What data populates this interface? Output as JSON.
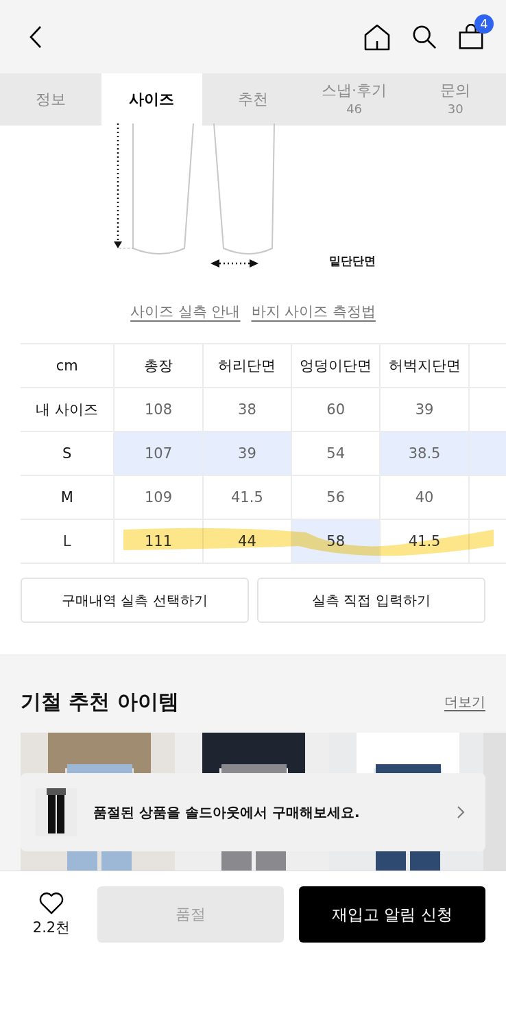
{
  "header": {
    "cart_count": "4"
  },
  "tabs": [
    {
      "label": "정보",
      "selected": false
    },
    {
      "label": "사이즈",
      "selected": true
    },
    {
      "label": "추천",
      "selected": false
    },
    {
      "label": "스냅·후기",
      "count": "46",
      "selected": false
    },
    {
      "label": "문의",
      "count": "30",
      "selected": false
    }
  ],
  "diagram": {
    "label": "밑단단면"
  },
  "links": [
    "사이즈 실측 안내",
    "바지 사이즈 측정법"
  ],
  "size_table": {
    "columns": [
      "cm",
      "총장",
      "허리단면",
      "엉덩이단면",
      "허벅지단면"
    ],
    "rows": [
      {
        "marked": false,
        "edge_highlighted": false,
        "cells": [
          {
            "value": "내 사이즈",
            "highlighted": false
          },
          {
            "value": "108",
            "highlighted": false
          },
          {
            "value": "38",
            "highlighted": false
          },
          {
            "value": "60",
            "highlighted": false
          },
          {
            "value": "39",
            "highlighted": false
          }
        ]
      },
      {
        "marked": false,
        "edge_highlighted": true,
        "cells": [
          {
            "value": "S",
            "highlighted": false
          },
          {
            "value": "107",
            "highlighted": true
          },
          {
            "value": "39",
            "highlighted": true
          },
          {
            "value": "54",
            "highlighted": false
          },
          {
            "value": "38.5",
            "highlighted": true
          }
        ]
      },
      {
        "marked": false,
        "edge_highlighted": false,
        "cells": [
          {
            "value": "M",
            "highlighted": false
          },
          {
            "value": "109",
            "highlighted": false
          },
          {
            "value": "41.5",
            "highlighted": false
          },
          {
            "value": "56",
            "highlighted": false
          },
          {
            "value": "40",
            "highlighted": false
          }
        ]
      },
      {
        "marked": true,
        "edge_highlighted": false,
        "cells": [
          {
            "value": "L",
            "highlighted": false
          },
          {
            "value": "111",
            "highlighted": false
          },
          {
            "value": "44",
            "highlighted": false
          },
          {
            "value": "58",
            "highlighted": true
          },
          {
            "value": "41.5",
            "highlighted": false
          }
        ]
      }
    ]
  },
  "action_buttons": [
    "구매내역 실측 선택하기",
    "실측 직접 입력하기"
  ],
  "recommend": {
    "title": "기철 추천 아이템",
    "more": "더보기"
  },
  "soldout_banner": {
    "text": "품절된 상품을 솔드아웃에서 구매해보세요."
  },
  "bottom_bar": {
    "likes": "2.2천",
    "soldout_button": "품절",
    "restock_button": "재입고 알림 신청"
  }
}
